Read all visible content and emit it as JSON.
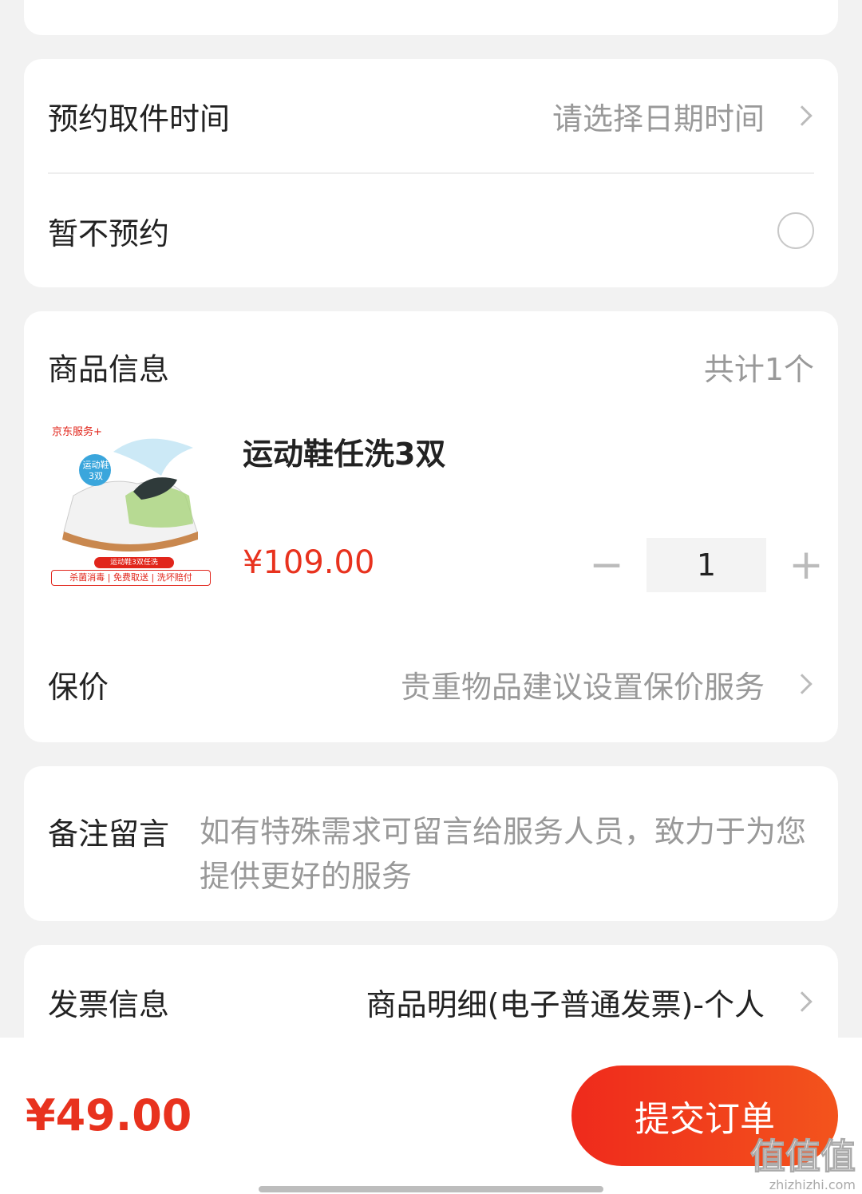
{
  "pickup": {
    "time_label": "预约取件时间",
    "time_placeholder": "请选择日期时间",
    "no_reserve_label": "暂不预约"
  },
  "product_section": {
    "title": "商品信息",
    "count": "共计1个",
    "item": {
      "name": "运动鞋任洗3双",
      "price": "¥109.00",
      "quantity": "1",
      "thumb_brand": "京东服务+",
      "thumb_badge": "运动鞋3双",
      "thumb_ribbon": "运动鞋3双任洗",
      "thumb_tags": "杀菌消毒 | 免费取送 | 洗坏赔付"
    },
    "insurance_label": "保价",
    "insurance_hint": "贵重物品建议设置保价服务"
  },
  "remark": {
    "label": "备注留言",
    "placeholder": "如有特殊需求可留言给服务人员，致力于为您提供更好的服务"
  },
  "invoice": {
    "label": "发票信息",
    "value": "商品明细(电子普通发票)-个人"
  },
  "footer": {
    "total": "¥49.00",
    "submit_label": "提交订单"
  },
  "watermark": {
    "brand": "值值值",
    "domain": "zhizhizhi.com"
  },
  "colors": {
    "accent": "#e8321e",
    "background": "#f2f2f2",
    "muted_text": "#999999"
  }
}
